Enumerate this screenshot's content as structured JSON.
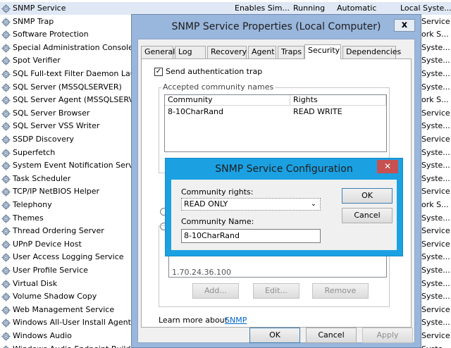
{
  "services": [
    {
      "name": "SNMP Service",
      "description": "Enables Sim...",
      "status": "Running",
      "startup": "Automatic",
      "logon": "Local Syste...",
      "selected": true
    },
    {
      "name": "SNMP Trap",
      "logon": "Service"
    },
    {
      "name": "Software Protection",
      "logon": "ork S..."
    },
    {
      "name": "Special Administration Console Helper",
      "logon": "Syste..."
    },
    {
      "name": "Spot Verifier",
      "logon": "Syste..."
    },
    {
      "name": "SQL Full-text Filter Daemon Launcher",
      "logon": "Syste..."
    },
    {
      "name": "SQL Server (MSSQLSERVER)",
      "logon": "Syste..."
    },
    {
      "name": "SQL Server Agent (MSSQLSERVER)",
      "logon": "ork S..."
    },
    {
      "name": "SQL Server Browser",
      "logon": "Service"
    },
    {
      "name": "SQL Server VSS Writer",
      "logon": "Syste..."
    },
    {
      "name": "SSDP Discovery",
      "logon": "Service"
    },
    {
      "name": "Superfetch",
      "logon": "Syste..."
    },
    {
      "name": "System Event Notification Service",
      "logon": "Syste..."
    },
    {
      "name": "Task Scheduler",
      "logon": "Syste..."
    },
    {
      "name": "TCP/IP NetBIOS Helper",
      "logon": "Service"
    },
    {
      "name": "Telephony",
      "logon": "ork S..."
    },
    {
      "name": "Themes",
      "logon": "Syste..."
    },
    {
      "name": "Thread Ordering Server",
      "logon": "Service"
    },
    {
      "name": "UPnP Device Host",
      "logon": "Service"
    },
    {
      "name": "User Access Logging Service",
      "logon": "Syste..."
    },
    {
      "name": "User Profile Service",
      "logon": "Syste..."
    },
    {
      "name": "Virtual Disk",
      "logon": "Syste..."
    },
    {
      "name": "Volume Shadow Copy",
      "logon": "Syste..."
    },
    {
      "name": "Web Management Service",
      "logon": "Service"
    },
    {
      "name": "Windows All-User Install Agent",
      "logon": "Syste..."
    },
    {
      "name": "Windows Audio",
      "logon": "Service"
    },
    {
      "name": "Windows Audio Endpoint Builder",
      "logon": "Syste..."
    }
  ],
  "props": {
    "title": "SNMP Service Properties (Local Computer)",
    "close": "x",
    "tabs": [
      "General",
      "Log On",
      "Recovery",
      "Agent",
      "Traps",
      "Security",
      "Dependencies"
    ],
    "active_tab": "Security",
    "send_auth_trap_label": "Send authentication trap",
    "send_auth_trap_checked": "✓",
    "accepted_group_title": "Accepted community names",
    "columns": [
      "Community",
      "Rights"
    ],
    "rows": [
      {
        "community": "8-10CharRand",
        "rights": "READ WRITE"
      }
    ],
    "hosts_fragment": "1.70.24.36.100",
    "add_label": "Add...",
    "edit_label": "Edit...",
    "remove_label": "Remove",
    "learn_more_text": "Learn more about",
    "learn_more_link": "SNMP",
    "ok_label": "OK",
    "cancel_label": "Cancel",
    "apply_label": "Apply"
  },
  "cfg": {
    "title": "SNMP Service Configuration",
    "close": "✕",
    "rights_label": "Community rights:",
    "rights_value": "READ ONLY",
    "name_label": "Community Name:",
    "name_value": "8-10CharRand",
    "ok_label": "OK",
    "cancel_label": "Cancel"
  },
  "colors": {
    "title_bar": "#99b6dc",
    "dialog_accent": "#1ba1e2",
    "close_red": "#c75050",
    "link": "#0066cc"
  }
}
